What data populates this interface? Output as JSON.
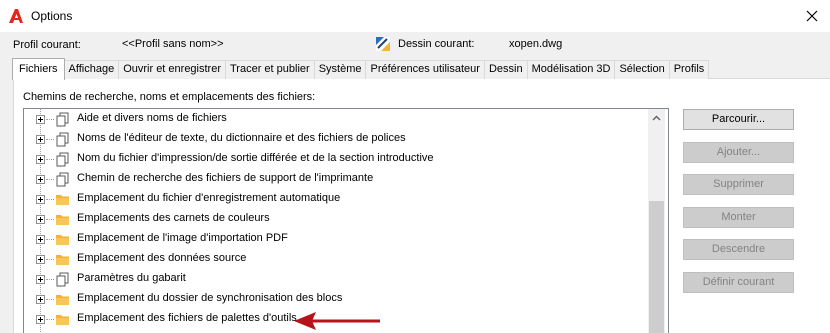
{
  "window": {
    "title": "Options",
    "close_label": "×"
  },
  "profile": {
    "label": "Profil courant:",
    "value": "<<Profil sans nom>>",
    "drawing_label": "Dessin courant:",
    "drawing_value": "xopen.dwg"
  },
  "tabs": [
    {
      "label": "Fichiers",
      "active": true
    },
    {
      "label": "Affichage"
    },
    {
      "label": "Ouvrir et enregistrer"
    },
    {
      "label": "Tracer et publier"
    },
    {
      "label": "Système"
    },
    {
      "label": "Préférences utilisateur"
    },
    {
      "label": "Dessin"
    },
    {
      "label": "Modélisation 3D"
    },
    {
      "label": "Sélection"
    },
    {
      "label": "Profils"
    }
  ],
  "files_panel": {
    "section_label": "Chemins de recherche, noms et emplacements des fichiers:",
    "tree_items": [
      {
        "label": "Aide et divers noms de fichiers",
        "icon": "documents-icon"
      },
      {
        "label": "Noms de l'éditeur de texte, du dictionnaire et des fichiers de polices",
        "icon": "documents-icon"
      },
      {
        "label": "Nom du fichier d'impression/de sortie différée et de la section introductive",
        "icon": "documents-icon"
      },
      {
        "label": "Chemin de recherche des fichiers de support de l'imprimante",
        "icon": "documents-icon"
      },
      {
        "label": "Emplacement du fichier d'enregistrement automatique",
        "icon": "folder-icon"
      },
      {
        "label": "Emplacements des carnets de couleurs",
        "icon": "folder-icon"
      },
      {
        "label": "Emplacement de l'image d'importation PDF",
        "icon": "folder-icon"
      },
      {
        "label": "Emplacement des données source",
        "icon": "folder-icon"
      },
      {
        "label": "Paramètres du gabarit",
        "icon": "documents-icon"
      },
      {
        "label": "Emplacement du dossier de synchronisation des blocs",
        "icon": "folder-icon"
      },
      {
        "label": "Emplacement des fichiers de palettes d'outils",
        "icon": "folder-icon"
      }
    ],
    "buttons": {
      "browse": "Parcourir...",
      "add": "Ajouter...",
      "remove": "Supprimer",
      "move_up": "Monter",
      "move_down": "Descendre",
      "set_current": "Définir courant"
    }
  },
  "colors": {
    "accent": "#e0291e",
    "folder": "#f2b437",
    "annotation_arrow": "#b8121b"
  }
}
